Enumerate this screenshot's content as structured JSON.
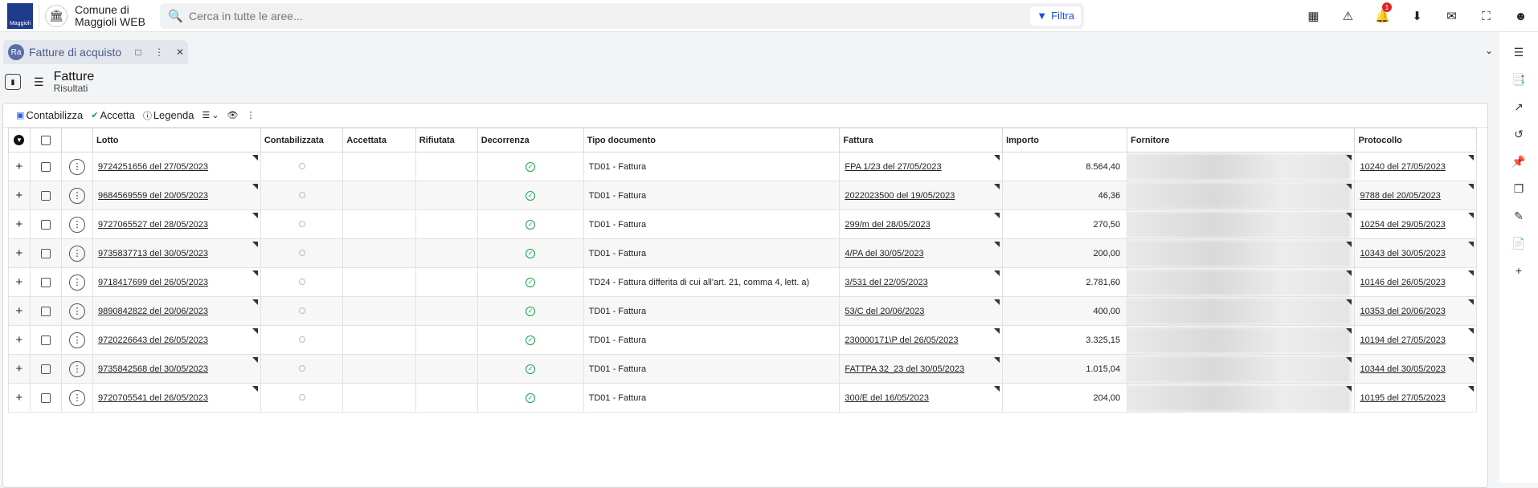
{
  "app": {
    "logo_text": "Maggioli",
    "name_line1": "Comune di",
    "name_line2": "Maggioli WEB"
  },
  "search": {
    "placeholder": "Cerca in tutte le aree...",
    "filter_label": "Filtra"
  },
  "header_icons": {
    "notifications_count": "1"
  },
  "tab": {
    "icon_text": "Ra",
    "label": "Fatture di acquisto"
  },
  "page": {
    "title": "Fatture",
    "subtitle": "Risultati"
  },
  "toolbar": {
    "contabilizza": "Contabilizza",
    "accetta": "Accetta",
    "legenda": "Legenda"
  },
  "table": {
    "headers": {
      "lotto": "Lotto",
      "contabilizzata": "Contabilizzata",
      "accettata": "Accettata",
      "rifiutata": "Rifiutata",
      "decorrenza": "Decorrenza",
      "tipo": "Tipo documento",
      "fattura": "Fattura",
      "importo": "Importo",
      "fornitore": "Fornitore",
      "protocollo": "Protocollo"
    },
    "rows": [
      {
        "lotto": "9724251656 del 27/05/2023",
        "tipo": "TD01 - Fattura",
        "fattura": "FPA 1/23 del 27/05/2023",
        "importo": "8.564,40",
        "protocollo": "10240 del 27/05/2023"
      },
      {
        "lotto": "9684569559 del 20/05/2023",
        "tipo": "TD01 - Fattura",
        "fattura": "2022023500 del 19/05/2023",
        "importo": "46,36",
        "protocollo": "9788 del 20/05/2023"
      },
      {
        "lotto": "9727065527 del 28/05/2023",
        "tipo": "TD01 - Fattura",
        "fattura": "299/m del 28/05/2023",
        "importo": "270,50",
        "protocollo": "10254 del 29/05/2023"
      },
      {
        "lotto": "9735837713 del 30/05/2023",
        "tipo": "TD01 - Fattura",
        "fattura": "4/PA del 30/05/2023",
        "importo": "200,00",
        "protocollo": "10343 del 30/05/2023"
      },
      {
        "lotto": "9718417699 del 26/05/2023",
        "tipo": "TD24 - Fattura differita di cui all'art. 21, comma 4, lett. a)",
        "fattura": "3/531 del 22/05/2023",
        "importo": "2.781,60",
        "protocollo": "10146 del 26/05/2023"
      },
      {
        "lotto": "9890842822 del 20/06/2023",
        "tipo": "TD01 - Fattura",
        "fattura": "53/C del 20/06/2023",
        "importo": "400,00",
        "protocollo": "10353 del 20/06/2023"
      },
      {
        "lotto": "9720226643 del 26/05/2023",
        "tipo": "TD01 - Fattura",
        "fattura": "230000171\\P del 26/05/2023",
        "importo": "3.325,15",
        "protocollo": "10194 del 27/05/2023"
      },
      {
        "lotto": "9735842568 del 30/05/2023",
        "tipo": "TD01 - Fattura",
        "fattura": "FATTPA 32_23 del 30/05/2023",
        "importo": "1.015,04",
        "protocollo": "10344 del 30/05/2023"
      },
      {
        "lotto": "9720705541 del 26/05/2023",
        "tipo": "TD01 - Fattura",
        "fattura": "300/E del 16/05/2023",
        "importo": "204,00",
        "protocollo": "10195 del 27/05/2023"
      }
    ]
  },
  "colors": {
    "accent": "#1d4ed8",
    "success": "#16a34a",
    "tab_bg": "#e4e6ee"
  }
}
